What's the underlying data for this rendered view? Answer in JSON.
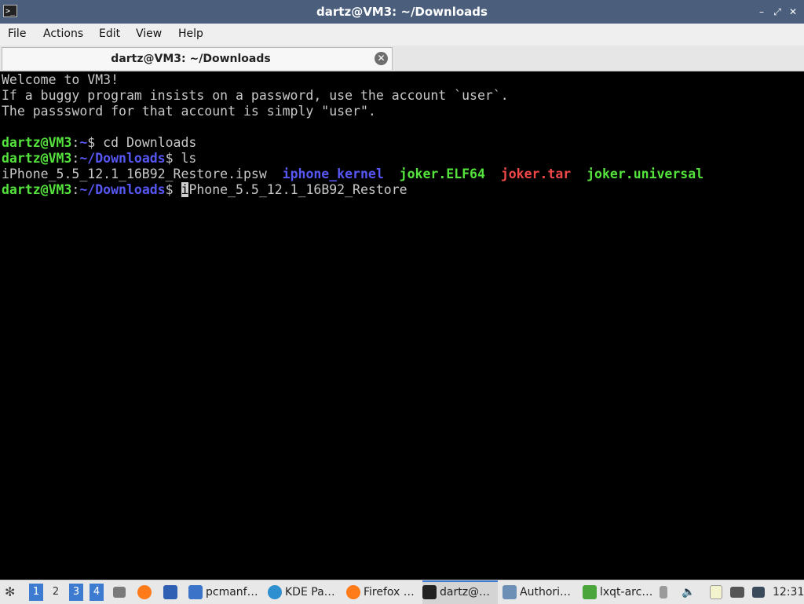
{
  "window": {
    "title": "dartz@VM3: ~/Downloads",
    "minimize": "–",
    "maximize": "⤢",
    "close": "✕",
    "app_icon": ">_"
  },
  "menu": [
    "File",
    "Actions",
    "Edit",
    "View",
    "Help"
  ],
  "tab": {
    "label": "dartz@VM3: ~/Downloads",
    "close": "✕"
  },
  "terminal": {
    "welcome": "Welcome to VM3!",
    "line2": "If a buggy program insists on a password, use the account `user`.",
    "line3": "The passsword for that account is simply \"user\".",
    "prompt_user": "dartz@VM3",
    "colon": ":",
    "home": "~",
    "downloads": "~/Downloads",
    "dollar": "$ ",
    "cmd1": "cd Downloads",
    "cmd2": "ls",
    "ls_items": [
      "iPhone_5.5_12.1_16B92_Restore.ipsw",
      "iphone_kernel",
      "joker.ELF64",
      "joker.tar",
      "joker.universal"
    ],
    "cursor_char": "i",
    "cmd3_rest": "Phone_5.5_12.1_16B92_Restore"
  },
  "taskbar": {
    "workspaces": [
      "1",
      "2",
      "3",
      "4"
    ],
    "tasks": [
      "pcmanf…",
      "KDE Pa…",
      "Firefox …",
      "dartz@…",
      "Authori…",
      "lxqt-arc…"
    ],
    "clock": "12:31"
  },
  "colors": {
    "prompt_green": "#54e33c",
    "path_blue": "#5757f5",
    "archive_red": "#f04848",
    "title_bar": "#4b5f7d"
  }
}
